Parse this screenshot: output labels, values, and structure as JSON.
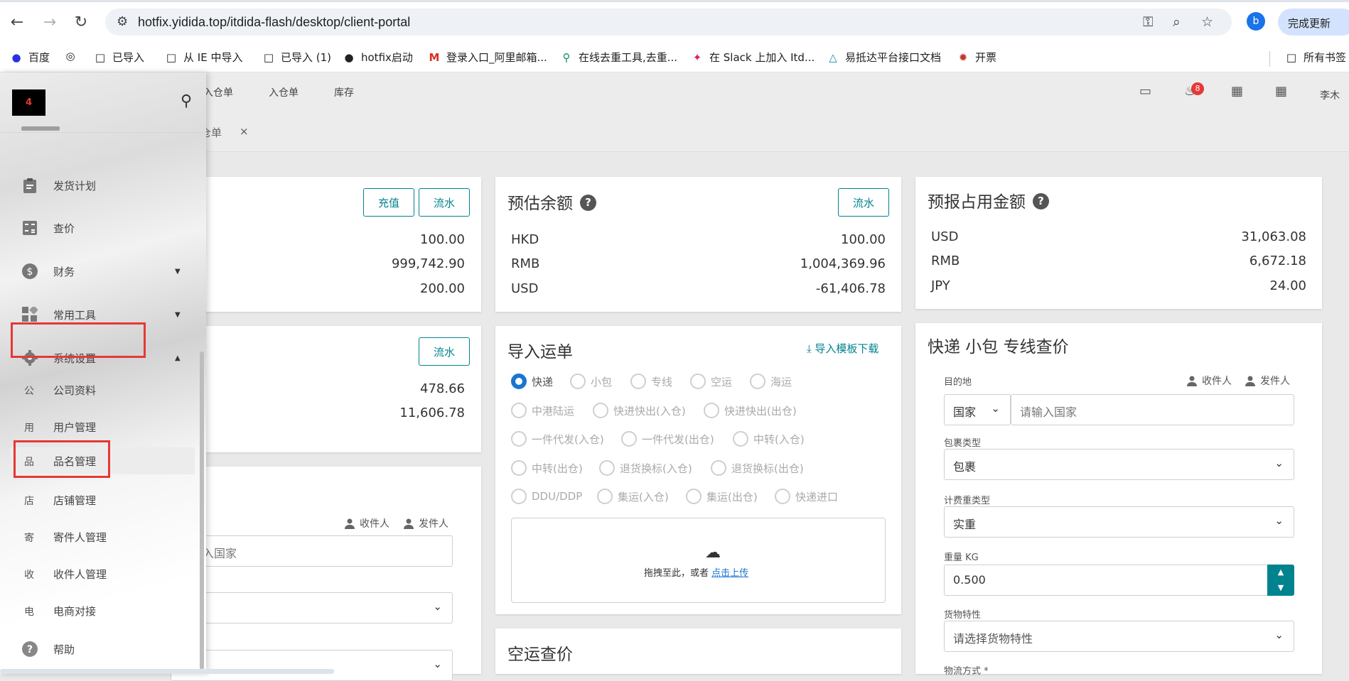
{
  "browser": {
    "url": "hotfix.yidida.top/itdida-flash/desktop/client-portal",
    "profile_initial": "b",
    "update_label": "完成更新",
    "bookmarks": [
      "百度",
      "已导入",
      "从 IE 中导入",
      "已导入 (1)",
      "hotfix启动",
      "登录入口_阿里邮箱...",
      "在线去重工具,去重...",
      "在 Slack 上加入 Itd...",
      "易抵达平台接口文档",
      "开票",
      "所有书签"
    ]
  },
  "header": {
    "nav": [
      "入仓单",
      "入仓单",
      "库存"
    ],
    "notification_count": "8",
    "user": "李木"
  },
  "tabs": {
    "active_partial": "仓单",
    "close_symbol": "×"
  },
  "sidebar": {
    "logo_text": "4",
    "items": [
      {
        "label": "发货计划",
        "icon": "clipboard-icon"
      },
      {
        "label": "查价",
        "icon": "calculator-icon"
      },
      {
        "label": "财务",
        "icon": "dollar-icon"
      },
      {
        "label": "常用工具",
        "icon": "widgets-icon"
      },
      {
        "label": "系统设置",
        "icon": "gear-icon"
      }
    ],
    "sub_items": [
      {
        "char": "公",
        "label": "公司资料"
      },
      {
        "char": "用",
        "label": "用户管理"
      },
      {
        "char": "品",
        "label": "品名管理"
      },
      {
        "char": "店",
        "label": "店铺管理"
      },
      {
        "char": "寄",
        "label": "寄件人管理"
      },
      {
        "char": "收",
        "label": "收件人管理"
      },
      {
        "char": "电",
        "label": "电商对接"
      }
    ],
    "help_label": "帮助"
  },
  "card_balance": {
    "btn_recharge": "充值",
    "btn_flow": "流水",
    "values": [
      "100.00",
      "999,742.90",
      "200.00"
    ]
  },
  "card_credit": {
    "btn_flow": "流水",
    "values": [
      "478.66",
      "11,606.78"
    ]
  },
  "card_query_partial": {
    "receiver": "收件人",
    "sender": "发件人",
    "country_placeholder": "入国家"
  },
  "card_estimated": {
    "title": "预估余额",
    "btn_flow": "流水",
    "rows": [
      {
        "currency": "HKD",
        "value": "100.00"
      },
      {
        "currency": "RMB",
        "value": "1,004,369.96"
      },
      {
        "currency": "USD",
        "value": "-61,406.78"
      }
    ]
  },
  "card_declared": {
    "title": "预报占用金额",
    "rows": [
      {
        "currency": "USD",
        "value": "31,063.08"
      },
      {
        "currency": "RMB",
        "value": "6,672.18"
      },
      {
        "currency": "JPY",
        "value": "24.00"
      }
    ]
  },
  "card_import": {
    "title": "导入运单",
    "template_link": "导入模板下载",
    "options": [
      [
        "快递",
        "小包",
        "专线",
        "空运",
        "海运"
      ],
      [
        "中港陆运",
        "快进快出(入仓)",
        "快进快出(出仓)"
      ],
      [
        "一件代发(入仓)",
        "一件代发(出仓)",
        "中转(入仓)"
      ],
      [
        "中转(出仓)",
        "退货换标(入仓)",
        "退货换标(出仓)"
      ],
      [
        "DDU/DDP",
        "集运(入仓)",
        "集运(出仓)",
        "快递进口"
      ]
    ],
    "selected": "快递",
    "upload_text": "拖拽至此，或者",
    "upload_link": "点击上传"
  },
  "card_air": {
    "title": "空运查价"
  },
  "card_quote": {
    "title": "快递 小包 专线查价",
    "destination_label": "目的地",
    "receiver": "收件人",
    "sender": "发件人",
    "country_select": "国家",
    "country_placeholder": "请输入国家",
    "package_type_label": "包裹类型",
    "package_type_value": "包裹",
    "weight_type_label": "计费重类型",
    "weight_type_value": "实重",
    "weight_label": "重量 KG",
    "weight_value": "0.500",
    "goods_label": "货物特性",
    "goods_placeholder": "请选择货物特性",
    "logistics_label": "物流方式 *"
  }
}
